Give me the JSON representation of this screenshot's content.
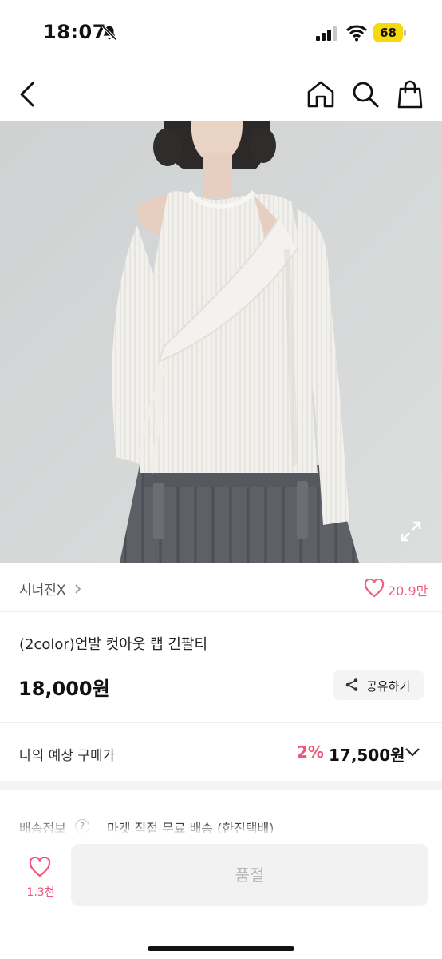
{
  "status_bar": {
    "time": "18:07",
    "battery_level": "68",
    "battery_color": "#f5d90a"
  },
  "nav": {
    "back_icon": "chevron-left-icon",
    "home_icon": "home-icon",
    "search_icon": "search-icon",
    "cart_icon": "shopping-bag-icon"
  },
  "product": {
    "shop_name": "시너진X",
    "likes": "20.9만",
    "title": "(2color)언발 컷아웃 랩 긴팔티",
    "price": "18,000원",
    "share_label": "공유하기"
  },
  "expected": {
    "label": "나의 예상 구매가",
    "discount_rate": "2%",
    "discount_price": "17,500원"
  },
  "shipping": {
    "label": "배송정보",
    "help": "?",
    "value": "마켓 직접 무료 배송 (한진택배)"
  },
  "bottom": {
    "wish_count": "1.3천",
    "soldout_label": "품절"
  },
  "colors": {
    "accent": "#f0547a",
    "like": "#f06080"
  }
}
